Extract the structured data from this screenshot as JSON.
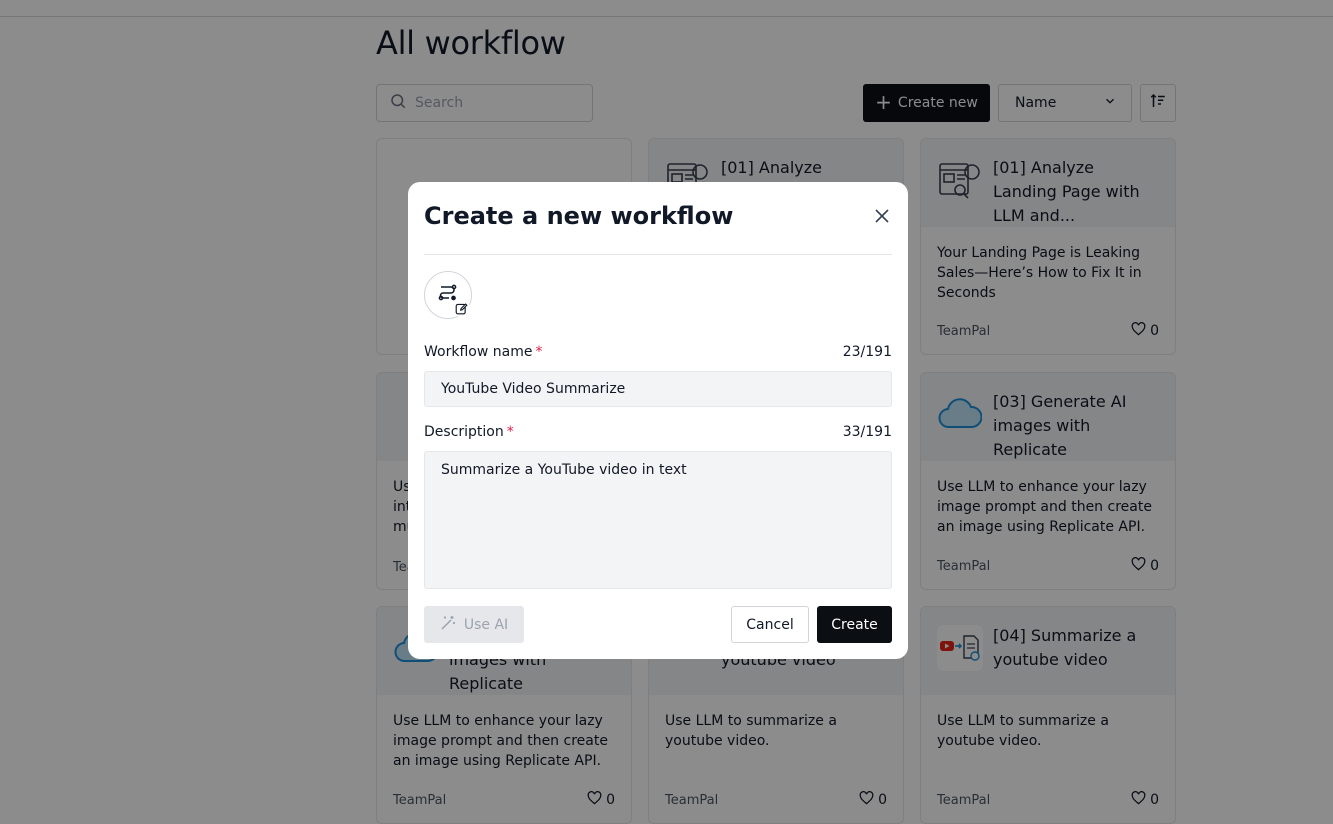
{
  "page": {
    "title": "All workflow",
    "search_placeholder": "Search",
    "create_new_label": "Create new",
    "sort_label": "Name"
  },
  "cards": [
    {
      "title": "",
      "description": "",
      "author": "",
      "likes": ""
    },
    {
      "title": "[01] Analyze Landing",
      "description": "",
      "author": "",
      "likes": ""
    },
    {
      "title": "[01] Analyze Landing Page with LLM and...",
      "description": "Your Landing Page is Leaking Sales—Here’s How to Fix It in Seconds",
      "author": "TeamPal",
      "likes": "0"
    },
    {
      "title": "",
      "description": "Us int mu",
      "author": "Tea",
      "likes": ""
    },
    {
      "title": "",
      "description": "",
      "author": "",
      "likes": ""
    },
    {
      "title": "[03] Generate AI images with Replicate",
      "description": "Use LLM to enhance your lazy image prompt and then create an image using Replicate API.",
      "author": "TeamPal",
      "likes": "0"
    },
    {
      "title": "images with Replicate",
      "description": "Use LLM to enhance your lazy image prompt and then create an image using Replicate API.",
      "author": "TeamPal",
      "likes": "0"
    },
    {
      "title": "youtube video",
      "description": "Use LLM to summarize a youtube video.",
      "author": "TeamPal",
      "likes": "0"
    },
    {
      "title": "[04] Summarize a youtube video",
      "description": "Use LLM to summarize a youtube video.",
      "author": "TeamPal",
      "likes": "0"
    }
  ],
  "modal": {
    "title": "Create a new workflow",
    "name_label": "Workflow name",
    "required_mark": "*",
    "name_counter": "23/191",
    "name_value": "YouTube Video Summarize",
    "description_label": "Description",
    "description_counter": "33/191",
    "description_value": "Summarize a YouTube video in text",
    "use_ai_label": "Use AI",
    "cancel_label": "Cancel",
    "create_label": "Create"
  },
  "colors": {
    "primary_button": "#0b0f14",
    "required": "#e11d48",
    "overlay": "rgba(0,0,0,0.45)"
  }
}
